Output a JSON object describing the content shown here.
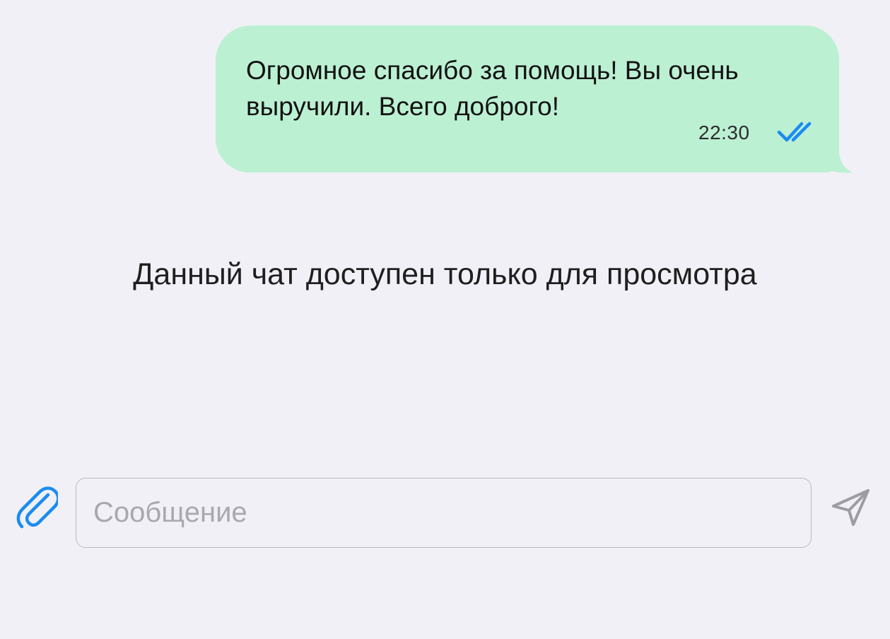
{
  "message": {
    "text": "Огромное спасибо за помощь! Вы очень выручили. Всего доброго!",
    "time": "22:30",
    "status_icon": "double-check-icon",
    "bubble_color": "#bcf0d3",
    "check_color": "#1a8cf0"
  },
  "notice": {
    "text": "Данный чат доступен только для просмотра"
  },
  "composer": {
    "placeholder": "Сообщение",
    "attach_icon": "paperclip-icon",
    "send_icon": "send-icon",
    "attach_color": "#1a8cf0",
    "send_color": "#9c9ca2"
  },
  "background_color": "#f1f0f6"
}
